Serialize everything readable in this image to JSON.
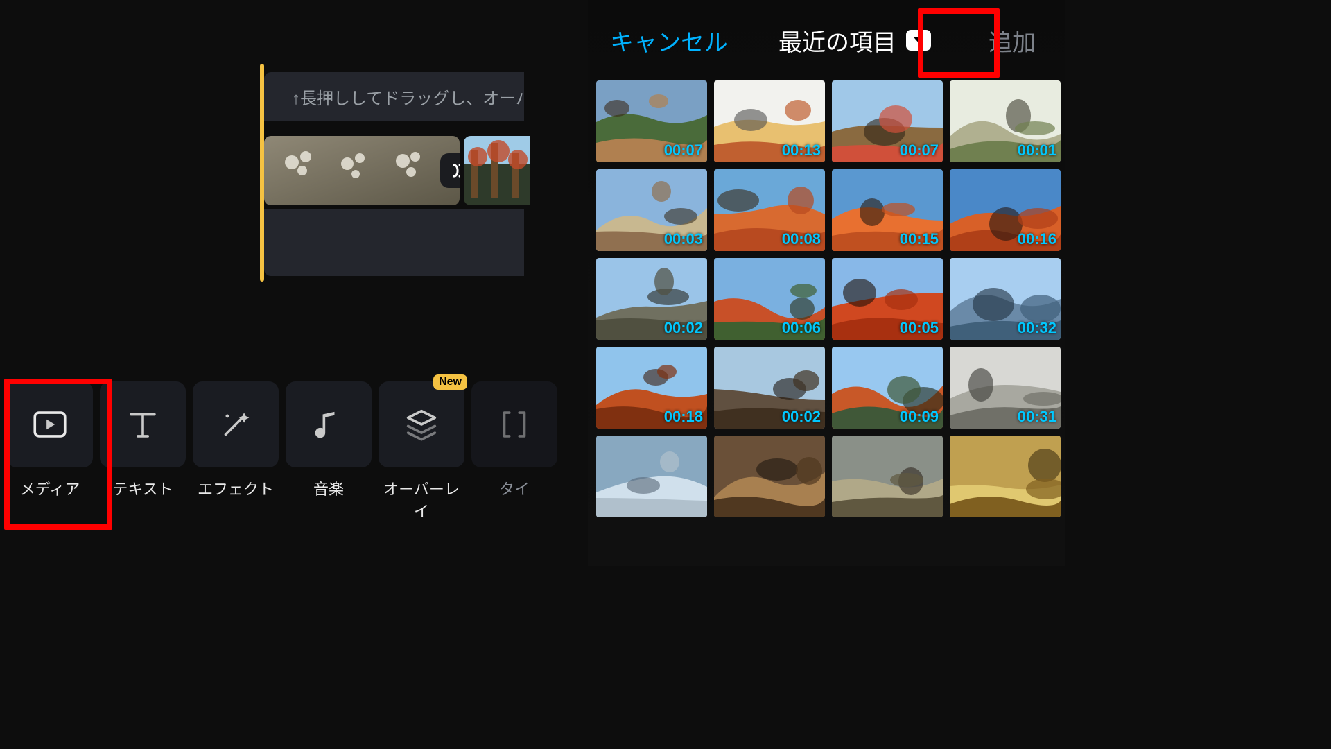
{
  "timeline": {
    "hint": "↑長押ししてドラッグし、オーバー"
  },
  "tools": [
    {
      "id": "media",
      "label": "メディア",
      "icon": "media"
    },
    {
      "id": "text",
      "label": "テキスト",
      "icon": "text"
    },
    {
      "id": "effect",
      "label": "エフェクト",
      "icon": "wand"
    },
    {
      "id": "music",
      "label": "音楽",
      "icon": "music"
    },
    {
      "id": "overlay",
      "label": "オーバーレイ",
      "icon": "layers",
      "badge": "New"
    },
    {
      "id": "title",
      "label": "タイ",
      "icon": "bracket",
      "faded": true
    }
  ],
  "picker": {
    "cancel": "キャンセル",
    "title": "最近の項目",
    "add": "追加",
    "clips": [
      {
        "dur": "00:07"
      },
      {
        "dur": "00:13"
      },
      {
        "dur": "00:07"
      },
      {
        "dur": "00:01"
      },
      {
        "dur": "00:03"
      },
      {
        "dur": "00:08"
      },
      {
        "dur": "00:15"
      },
      {
        "dur": "00:16"
      },
      {
        "dur": "00:02"
      },
      {
        "dur": "00:06"
      },
      {
        "dur": "00:05"
      },
      {
        "dur": "00:32"
      },
      {
        "dur": "00:18"
      },
      {
        "dur": "00:02"
      },
      {
        "dur": "00:09"
      },
      {
        "dur": "00:31"
      },
      {
        "dur": ""
      },
      {
        "dur": ""
      },
      {
        "dur": ""
      },
      {
        "dur": ""
      }
    ]
  },
  "highlights": {
    "media": true,
    "add": true
  },
  "colors": {
    "accent": "#00b2ff",
    "brand": "#f5c242",
    "highlight": "#ff0000"
  }
}
